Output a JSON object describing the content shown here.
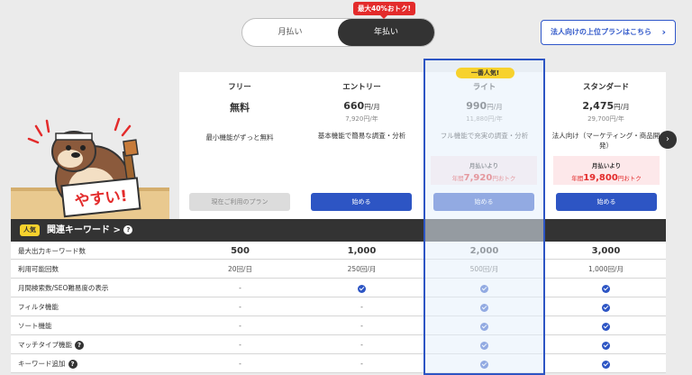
{
  "billing_toggle": {
    "monthly": "月払い",
    "annual": "年払い",
    "promo": "最大40%おトク!"
  },
  "corporate_link": {
    "label": "法人向けの上位プランはこちら",
    "arrow": "›"
  },
  "popular_badge": "一番人気!",
  "plans": [
    {
      "name": "フリー",
      "price": "無料",
      "unit": "",
      "annual": "",
      "desc": "最小機能がずっと無料",
      "button": "現在ご利用のプラン",
      "button_style": "gray"
    },
    {
      "name": "エントリー",
      "price": "660",
      "unit": "円/月",
      "annual": "7,920円/年",
      "desc": "基本機能で簡易な調査・分析",
      "button": "始める",
      "button_style": "blue"
    },
    {
      "name": "ライト",
      "price": "990",
      "unit": "円/月",
      "annual": "11,880円/年",
      "desc": "フル機能で充実の調査・分析",
      "button": "始める",
      "button_style": "blue",
      "saving": {
        "line1": "月払いより",
        "prefix": "年間",
        "amount": "7,920",
        "suffix": "円おトク"
      }
    },
    {
      "name": "スタンダード",
      "price": "2,475",
      "unit": "円/月",
      "annual": "29,700円/年",
      "desc": "法人向け（マーケティング・商品開発）",
      "button": "始める",
      "button_style": "blue",
      "saving": {
        "line1": "月払いより",
        "prefix": "年間",
        "amount": "19,800",
        "suffix": "円おトク"
      }
    }
  ],
  "mascot": {
    "sign": "やすい!"
  },
  "section": {
    "tag": "人気",
    "title": "関連キーワード",
    "chevron": ">"
  },
  "rows": [
    {
      "label": "最大出力キーワード数",
      "values": [
        "500",
        "1,000",
        "2,000",
        "3,000"
      ],
      "big": true
    },
    {
      "label": "利用可能回数",
      "values": [
        "20回/日",
        "250回/月",
        "500回/月",
        "1,000回/月"
      ]
    },
    {
      "label": "月間検索数/SEO難易度の表示",
      "values": [
        "-",
        "check",
        "check",
        "check"
      ]
    },
    {
      "label": "フィルタ機能",
      "values": [
        "-",
        "-",
        "check",
        "check"
      ]
    },
    {
      "label": "ソート機能",
      "values": [
        "-",
        "-",
        "check",
        "check"
      ]
    },
    {
      "label": "マッチタイプ機能",
      "values": [
        "-",
        "-",
        "check",
        "check"
      ],
      "help": true
    },
    {
      "label": "キーワード追加",
      "values": [
        "-",
        "-",
        "check",
        "check"
      ],
      "help": true
    }
  ],
  "colors": {
    "accent": "#2d55c4",
    "promo": "#e32b2b",
    "badge": "#f7d22d"
  }
}
